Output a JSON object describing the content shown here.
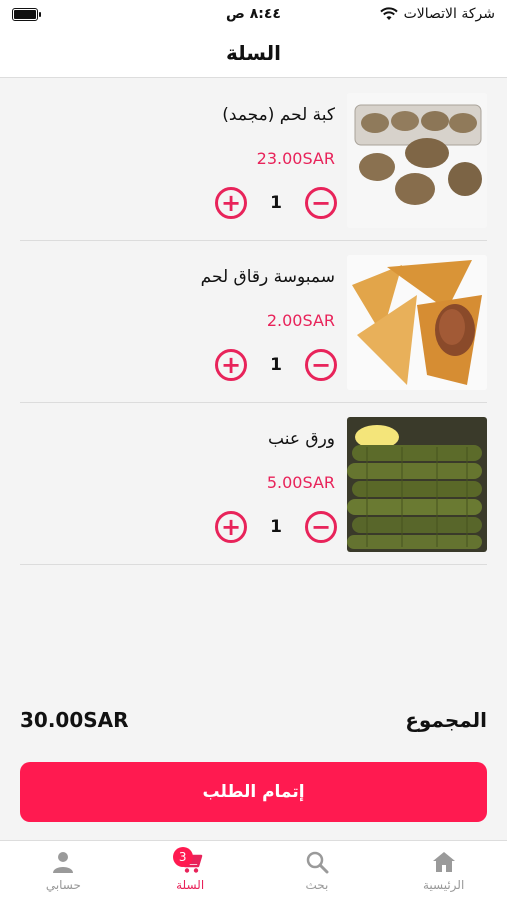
{
  "status_bar": {
    "carrier": "شركة الاتصالات",
    "time": "٨:٤٤ ص"
  },
  "header": {
    "title": "السلة"
  },
  "cart": {
    "items": [
      {
        "name": "كبة لحم (مجمد)",
        "price": "23.00SAR",
        "quantity": "1",
        "image": "kibbeh-photo"
      },
      {
        "name": "سمبوسة رقاق لحم",
        "price": "2.00SAR",
        "quantity": "1",
        "image": "samosa-photo"
      },
      {
        "name": "ورق عنب",
        "price": "5.00SAR",
        "quantity": "1",
        "image": "grape-leaves-photo"
      }
    ],
    "plus_symbol": "+",
    "minus_symbol": "−"
  },
  "summary": {
    "total_label": "المجموع",
    "total_value": "30.00SAR"
  },
  "checkout": {
    "label": "إتمام الطلب"
  },
  "tab_bar": {
    "tabs": [
      {
        "label": "حسابي",
        "icon": "person-icon"
      },
      {
        "label": "السلة",
        "icon": "cart-icon",
        "badge": "3"
      },
      {
        "label": "بحث",
        "icon": "search-icon"
      },
      {
        "label": "الرئيسية",
        "icon": "home-icon"
      }
    ],
    "active_tab": "السلة"
  },
  "colors": {
    "accent": "#e8235a",
    "checkout": "#ff1a50",
    "background": "#f4f4f4"
  }
}
